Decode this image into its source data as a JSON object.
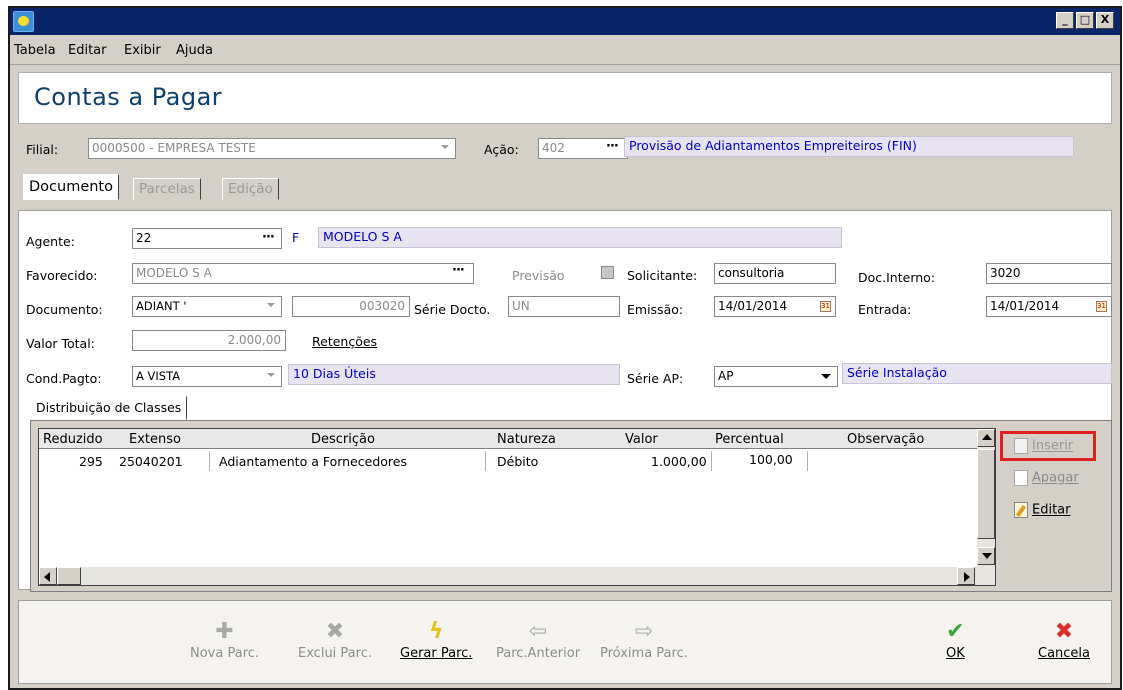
{
  "window": {
    "minimize": "_",
    "maximize": "□",
    "close": "X"
  },
  "menu": [
    "Tabela",
    "Editar",
    "Exibir",
    "Ajuda"
  ],
  "page_title": "Contas a Pagar",
  "filial": {
    "label": "Filial:",
    "value": "0000500 - EMPRESA TESTE"
  },
  "acao": {
    "label": "Ação:",
    "code": "402",
    "description": "Provisão de Adiantamentos Empreiteiros (FIN)"
  },
  "tabs": [
    "Documento",
    "Parcelas",
    "Edição"
  ],
  "form": {
    "agente_label": "Agente:",
    "agente_value": "22",
    "agente_type": "F",
    "agente_name": "MODELO S A",
    "favorecido_label": "Favorecido:",
    "favorecido_value": "MODELO S A",
    "previsao_label": "Previsão",
    "solicitante_label": "Solicitante:",
    "solicitante_value": "consultoria",
    "doc_interno_label": "Doc.Interno:",
    "doc_interno_value": "3020",
    "documento_label": "Documento:",
    "documento_value": "ADIANT '",
    "documento_number": "003020",
    "serie_docto_label": "Série Docto.",
    "serie_docto_value": "UN",
    "emissao_label": "Emissão:",
    "emissao_value": "14/01/2014",
    "entrada_label": "Entrada:",
    "entrada_value": "14/01/2014",
    "valor_total_label": "Valor Total:",
    "valor_total_value": "2.000,00",
    "retencoes_label": "Retenções",
    "cond_pagto_label": "Cond.Pagto:",
    "cond_pagto_value": "A VISTA",
    "cond_pagto_desc": "10 Dias Úteis",
    "serie_ap_label": "Série AP:",
    "serie_ap_value": "AP",
    "serie_ap_desc": "Série Instalação"
  },
  "subtab": "Distribuição de Classes",
  "grid": {
    "headers": [
      "Reduzido",
      "Extenso",
      "Descrição",
      "Natureza",
      "Valor",
      "Percentual",
      "Observação"
    ],
    "rows": [
      {
        "reduzido": "295",
        "extenso": "25040201",
        "descricao": "Adiantamento a Fornecedores",
        "natureza": "Débito",
        "valor": "1.000,00",
        "percentual": "100,00",
        "observacao": ""
      }
    ]
  },
  "side_buttons": {
    "inserir": "Inserir",
    "apagar": "Apagar",
    "editar": "Editar"
  },
  "footer": {
    "nova_parc": "Nova Parc.",
    "exclui_parc": "Exclui Parc.",
    "gerar_parc": "Gerar Parc.",
    "parc_anterior": "Parc.Anterior",
    "proxima_parc": "Próxima Parc.",
    "ok": "OK",
    "cancela": "Cancela"
  },
  "colors": {
    "title_bar": "#0a246a",
    "description_text": "#0000cc",
    "highlight_border": "#e02020",
    "ok_green": "#3aa635",
    "cancel_red": "#d83030"
  }
}
